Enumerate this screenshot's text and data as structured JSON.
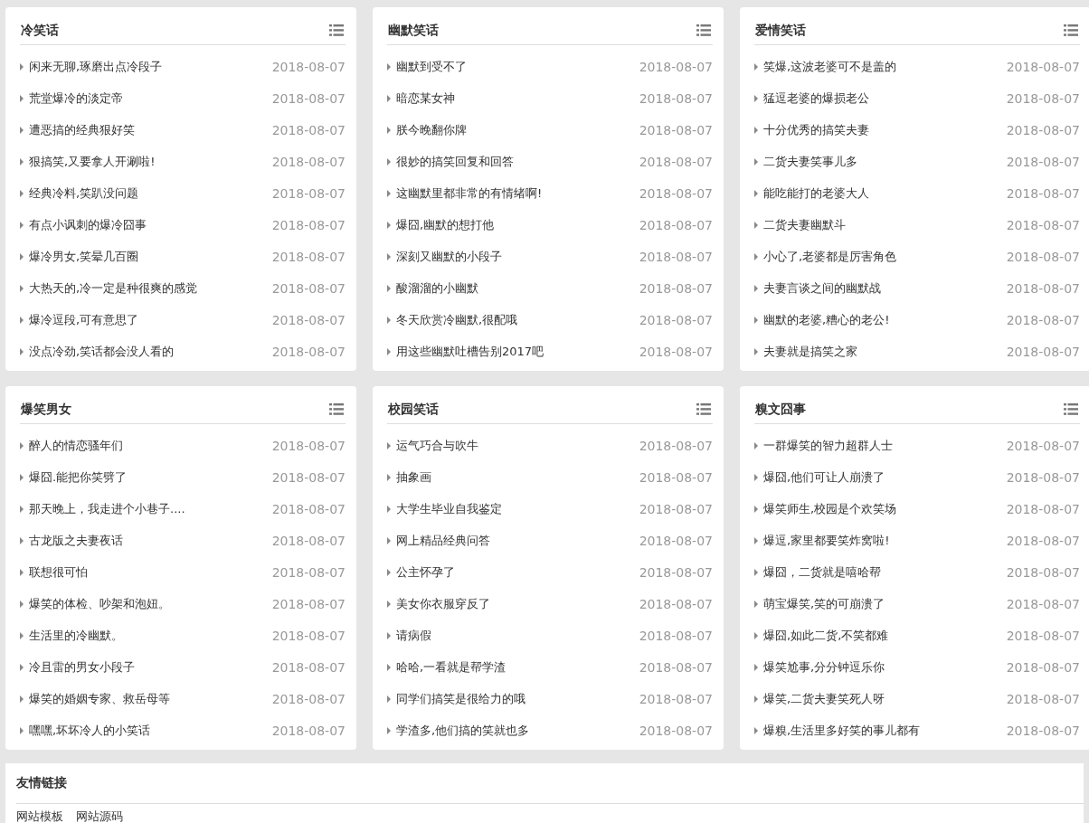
{
  "sections": [
    {
      "title": "冷笑话",
      "items": [
        {
          "title": "闲来无聊,琢磨出点冷段子",
          "date": "2018-08-07"
        },
        {
          "title": "荒堂爆冷的淡定帝",
          "date": "2018-08-07"
        },
        {
          "title": "遭恶搞的经典狠好笑",
          "date": "2018-08-07"
        },
        {
          "title": "狠搞笑,又要拿人开涮啦!",
          "date": "2018-08-07"
        },
        {
          "title": "经典冷料,笑趴没问题",
          "date": "2018-08-07"
        },
        {
          "title": "有点小讽刺的爆冷囧事",
          "date": "2018-08-07"
        },
        {
          "title": "爆冷男女,笑晕几百圈",
          "date": "2018-08-07"
        },
        {
          "title": "大热天的,冷一定是种很爽的感觉",
          "date": "2018-08-07"
        },
        {
          "title": "爆冷逗段,可有意思了",
          "date": "2018-08-07"
        },
        {
          "title": "没点冷劲,笑话都会没人看的",
          "date": "2018-08-07"
        }
      ]
    },
    {
      "title": "幽默笑话",
      "items": [
        {
          "title": "幽默到受不了",
          "date": "2018-08-07"
        },
        {
          "title": "暗恋某女神",
          "date": "2018-08-07"
        },
        {
          "title": "朕今晚翻你牌",
          "date": "2018-08-07"
        },
        {
          "title": "很妙的搞笑回复和回答",
          "date": "2018-08-07"
        },
        {
          "title": "这幽默里都非常的有情绪啊!",
          "date": "2018-08-07"
        },
        {
          "title": "爆囧,幽默的想打他",
          "date": "2018-08-07"
        },
        {
          "title": "深刻又幽默的小段子",
          "date": "2018-08-07"
        },
        {
          "title": "酸溜溜的小幽默",
          "date": "2018-08-07"
        },
        {
          "title": "冬天欣赏冷幽默,很配哦",
          "date": "2018-08-07"
        },
        {
          "title": "用这些幽默吐槽告别2017吧",
          "date": "2018-08-07"
        }
      ]
    },
    {
      "title": "爱情笑话",
      "items": [
        {
          "title": "笑爆,这波老婆可不是盖的",
          "date": "2018-08-07"
        },
        {
          "title": "猛逗老婆的爆损老公",
          "date": "2018-08-07"
        },
        {
          "title": "十分优秀的搞笑夫妻",
          "date": "2018-08-07"
        },
        {
          "title": "二货夫妻笑事儿多",
          "date": "2018-08-07"
        },
        {
          "title": "能吃能打的老婆大人",
          "date": "2018-08-07"
        },
        {
          "title": "二货夫妻幽默斗",
          "date": "2018-08-07"
        },
        {
          "title": "小心了,老婆都是厉害角色",
          "date": "2018-08-07"
        },
        {
          "title": "夫妻言谈之间的幽默战",
          "date": "2018-08-07"
        },
        {
          "title": "幽默的老婆,糟心的老公!",
          "date": "2018-08-07"
        },
        {
          "title": "夫妻就是搞笑之家",
          "date": "2018-08-07"
        }
      ]
    },
    {
      "title": "爆笑男女",
      "items": [
        {
          "title": "醉人的情恋骚年们",
          "date": "2018-08-07"
        },
        {
          "title": "爆囧.能把你笑劈了",
          "date": "2018-08-07"
        },
        {
          "title": "那天晚上，我走进个小巷子....",
          "date": "2018-08-07"
        },
        {
          "title": "古龙版之夫妻夜话",
          "date": "2018-08-07"
        },
        {
          "title": "联想很可怕",
          "date": "2018-08-07"
        },
        {
          "title": "爆笑的体检、吵架和泡妞。",
          "date": "2018-08-07"
        },
        {
          "title": "生活里的冷幽默。",
          "date": "2018-08-07"
        },
        {
          "title": "冷且雷的男女小段子",
          "date": "2018-08-07"
        },
        {
          "title": "爆笑的婚姻专家、救岳母等",
          "date": "2018-08-07"
        },
        {
          "title": "嘿嘿,坏坏冷人的小笑话",
          "date": "2018-08-07"
        }
      ]
    },
    {
      "title": "校园笑话",
      "items": [
        {
          "title": "运气巧合与吹牛",
          "date": "2018-08-07"
        },
        {
          "title": "抽象画",
          "date": "2018-08-07"
        },
        {
          "title": "大学生毕业自我鉴定",
          "date": "2018-08-07"
        },
        {
          "title": "网上精品经典问答",
          "date": "2018-08-07"
        },
        {
          "title": "公主怀孕了",
          "date": "2018-08-07"
        },
        {
          "title": "美女你衣服穿反了",
          "date": "2018-08-07"
        },
        {
          "title": "请病假",
          "date": "2018-08-07"
        },
        {
          "title": "哈哈,一看就是帮学渣",
          "date": "2018-08-07"
        },
        {
          "title": "同学们搞笑是很给力的哦",
          "date": "2018-08-07"
        },
        {
          "title": "学渣多,他们搞的笑就也多",
          "date": "2018-08-07"
        }
      ]
    },
    {
      "title": "糗文囧事",
      "items": [
        {
          "title": "一群爆笑的智力超群人士",
          "date": "2018-08-07"
        },
        {
          "title": "爆囧,他们可让人崩溃了",
          "date": "2018-08-07"
        },
        {
          "title": "爆笑师生,校园是个欢笑场",
          "date": "2018-08-07"
        },
        {
          "title": "爆逗,家里都要笑炸窝啦!",
          "date": "2018-08-07"
        },
        {
          "title": "爆囧，二货就是嘻哈帮",
          "date": "2018-08-07"
        },
        {
          "title": "萌宝爆笑,笑的可崩溃了",
          "date": "2018-08-07"
        },
        {
          "title": "爆囧,如此二货,不笑都难",
          "date": "2018-08-07"
        },
        {
          "title": "爆笑尬事,分分钟逗乐你",
          "date": "2018-08-07"
        },
        {
          "title": "爆笑,二货夫妻笑死人呀",
          "date": "2018-08-07"
        },
        {
          "title": "爆糗,生活里多好笑的事儿都有",
          "date": "2018-08-07"
        }
      ]
    }
  ],
  "friend_links": {
    "title": "友情链接",
    "links": [
      "网站模板",
      "网站源码"
    ]
  }
}
